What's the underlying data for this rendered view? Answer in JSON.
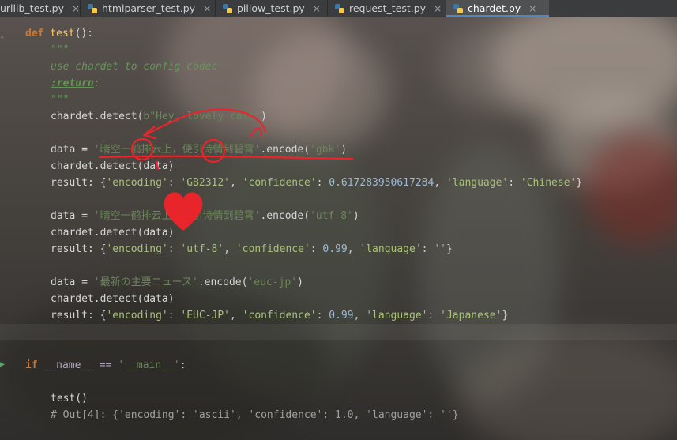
{
  "tabs": [
    {
      "label": "urllib_test.py",
      "active": false
    },
    {
      "label": "htmlparser_test.py",
      "active": false
    },
    {
      "label": "pillow_test.py",
      "active": false
    },
    {
      "label": "request_test.py",
      "active": false
    },
    {
      "label": "chardet.py",
      "active": true
    }
  ],
  "tab_close_glyph": "×",
  "code": {
    "def_kw": "def",
    "def_name": "test",
    "def_rest": "():",
    "doc_open": "\"\"\"",
    "doc_text": "use chardet to config codec",
    "doc_return": ":return",
    "doc_colon": ":",
    "doc_close": "\"\"\"",
    "detect1_pre": "chardet.",
    "detect1_fn": "detect",
    "detect1_arg": "b\"Hey, lovely cat!\"",
    "detect1_close": ")",
    "data1_pre": "data = ",
    "data1_str": "'晴空一鹤排云上，便引诗情到碧霄'",
    "data1_enc": ".encode(",
    "data1_arg": "'gbk'",
    "data1_close": ")",
    "detect2": "chardet.detect(data)",
    "result1_pre": "result: {",
    "result1_k1": "'encoding'",
    "result1_sep1": ": ",
    "result1_v1": "'GB2312'",
    "result1_sep2": ", ",
    "result1_k2": "'confidence'",
    "result1_sep3": ": ",
    "result1_v2": "0.617283950617284",
    "result1_sep4": ", ",
    "result1_k3": "'language'",
    "result1_sep5": ": ",
    "result1_v3": "'Chinese'",
    "result1_close": "}",
    "data2_pre": "data = ",
    "data2_str": "'晴空一鹤排云上，便引诗情到碧霄'",
    "data2_enc": ".encode(",
    "data2_arg": "'utf-8'",
    "data2_close": ")",
    "detect3": "chardet.detect(data)",
    "result2_pre": "result: {",
    "result2_k1": "'encoding'",
    "result2_v1": "'utf-8'",
    "result2_k2": "'confidence'",
    "result2_v2": "0.99",
    "result2_k3": "'language'",
    "result2_v3": "''",
    "result2_close": "}",
    "data3_pre": "data = ",
    "data3_str": "'最新の主要ニュース'",
    "data3_enc": ".encode(",
    "data3_arg": "'euc-jp'",
    "data3_close": ")",
    "detect4": "chardet.detect(data)",
    "result3_pre": "result: {",
    "result3_k1": "'encoding'",
    "result3_v1": "'EUC-JP'",
    "result3_k2": "'confidence'",
    "result3_v2": "0.99",
    "result3_k3": "'language'",
    "result3_v3": "'Japanese'",
    "result3_close": "}",
    "main_if": "if",
    "main_rest1": " __name__ == ",
    "main_str": "'__main__'",
    "main_rest2": ":",
    "call": "test()",
    "out_comment": "# Out[4]: {'encoding': 'ascii', 'confidence': 1.0, 'language': ''}"
  },
  "colors": {
    "annotation_red": "#e8252b",
    "tab_accent": "#4a88c7",
    "keyword": "#cc7832",
    "string": "#6a8759",
    "function": "#ffc66d"
  },
  "icons": [
    "python-file-icon",
    "close-icon",
    "heart-icon",
    "run-arrow-icon"
  ]
}
